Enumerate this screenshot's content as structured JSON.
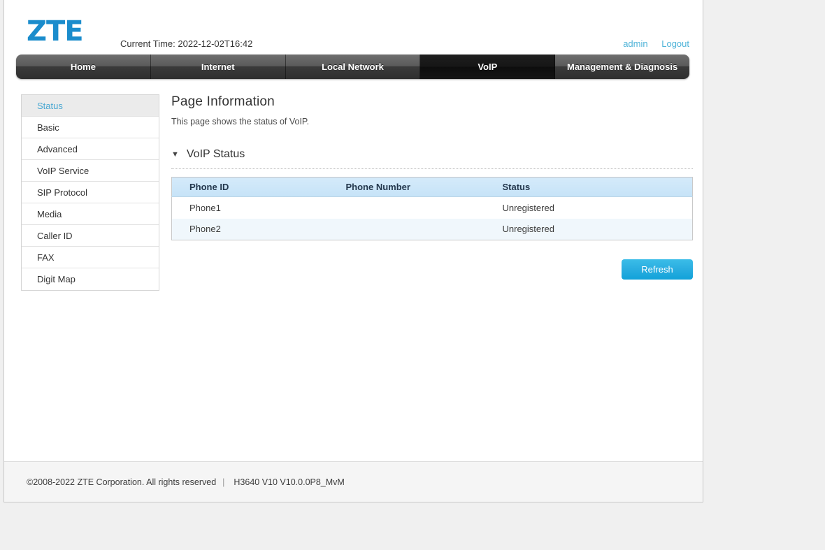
{
  "brand": {
    "logo_text": "ZTE",
    "logo_color": "#1a8ccc"
  },
  "header": {
    "current_time_label": "Current Time: 2022-12-02T16:42",
    "user_link": "admin",
    "logout_link": "Logout",
    "link_color": "#4eb3d8"
  },
  "nav": {
    "tabs": [
      {
        "label": "Home",
        "active": false
      },
      {
        "label": "Internet",
        "active": false
      },
      {
        "label": "Local Network",
        "active": false
      },
      {
        "label": "VoIP",
        "active": true
      },
      {
        "label": "Management & Diagnosis",
        "active": false
      }
    ]
  },
  "sidebar": {
    "items": [
      {
        "label": "Status",
        "active": true
      },
      {
        "label": "Basic",
        "active": false
      },
      {
        "label": "Advanced",
        "active": false
      },
      {
        "label": "VoIP Service",
        "active": false
      },
      {
        "label": "SIP Protocol",
        "active": false
      },
      {
        "label": "Media",
        "active": false
      },
      {
        "label": "Caller ID",
        "active": false
      },
      {
        "label": "FAX",
        "active": false
      },
      {
        "label": "Digit Map",
        "active": false
      }
    ],
    "active_text_color": "#4aa8d2",
    "active_bg_color": "#ebebeb"
  },
  "main": {
    "page_title": "Page Information",
    "page_description": "This page shows the status of VoIP.",
    "section": {
      "caret_glyph": "▼",
      "title": "VoIP Status"
    },
    "table": {
      "columns": [
        "Phone ID",
        "Phone Number",
        "Status"
      ],
      "rows": [
        {
          "phone_id": "Phone1",
          "phone_number": "",
          "status": "Unregistered"
        },
        {
          "phone_id": "Phone2",
          "phone_number": "",
          "status": "Unregistered"
        }
      ],
      "header_bg_color": "#c6e3f8"
    },
    "refresh_button": {
      "label": "Refresh",
      "color": "#29ade0"
    }
  },
  "footer": {
    "copyright": "©2008-2022 ZTE Corporation. All rights reserved",
    "separator": "|",
    "model": "H3640 V10 V10.0.0P8_MvM"
  }
}
